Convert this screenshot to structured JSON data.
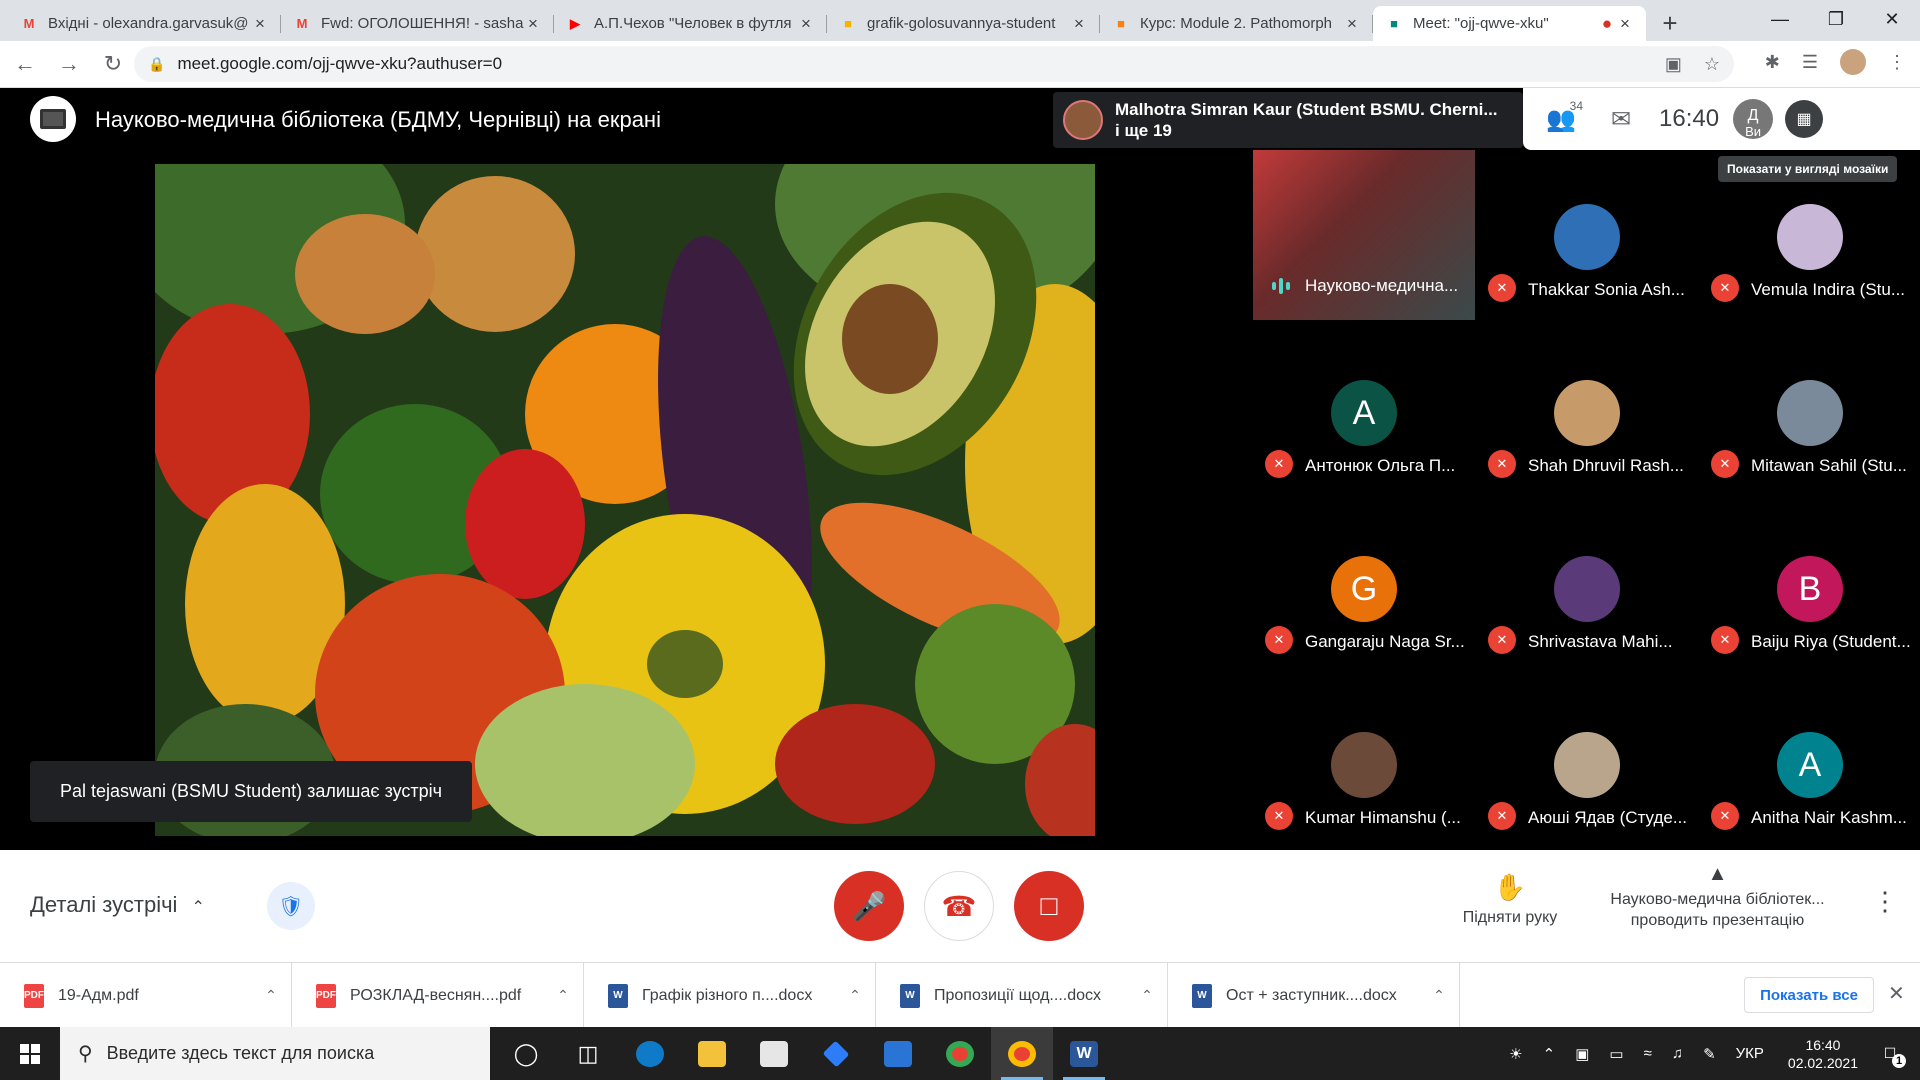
{
  "browser": {
    "tabs": [
      {
        "title": "Вхідні - olexandra.garvasuk@",
        "icon": "gmail-icon",
        "color": "#ea4335"
      },
      {
        "title": "Fwd: ОГОЛОШЕННЯ! - sasha",
        "icon": "gmail-icon",
        "color": "#ea4335"
      },
      {
        "title": "А.П.Чехов \"Человек в футля",
        "icon": "youtube-icon",
        "color": "#ff0000"
      },
      {
        "title": "grafik-golosuvannya-student",
        "icon": "doc-icon",
        "color": "#f4b400"
      },
      {
        "title": "Курс: Module 2. Pathomorph",
        "icon": "moodle-icon",
        "color": "#f98012"
      },
      {
        "title": "Meet: \"ojj-qwve-xku\"",
        "icon": "meet-icon",
        "color": "#00897b"
      }
    ],
    "url": "meet.google.com/ojj-qwve-xku?authuser=0"
  },
  "meet": {
    "presenter_title": "Науково-медична бібліотека (БДМУ, Чернівці) на екрані",
    "active_speaker": "Malhotra Simran Kaur (Student BSMU. Cherni...",
    "others": "і ще 19",
    "participant_count": "34",
    "time": "16:40",
    "you_label": "Ви",
    "you_initial": "Д",
    "tooltip": "Показати у вигляді мозаїки",
    "notice": "Pal tejaswani (BSMU Student) залишає зустріч",
    "participants": [
      {
        "name": "Науково-медична...",
        "initial": "",
        "color": "#8b3a3a",
        "speaking": true
      },
      {
        "name": "Thakkar Sonia Ash...",
        "initial": "",
        "color": "#2f6fb5",
        "speaking": false
      },
      {
        "name": "Vemula Indira (Stu...",
        "initial": "",
        "color": "#c9b7d8",
        "speaking": false
      },
      {
        "name": "Антонюк Ольга П...",
        "initial": "A",
        "color": "#0b5345",
        "speaking": false
      },
      {
        "name": "Shah Dhruvil Rash...",
        "initial": "",
        "color": "#c79a6a",
        "speaking": false
      },
      {
        "name": "Mitawan Sahil (Stu...",
        "initial": "",
        "color": "#7a8a9a",
        "speaking": false
      },
      {
        "name": "Gangaraju Naga Sr...",
        "initial": "G",
        "color": "#e8710a",
        "speaking": false
      },
      {
        "name": "Shrivastava Mahi...",
        "initial": "",
        "color": "#5b3a7a",
        "speaking": false
      },
      {
        "name": "Baiju Riya (Student...",
        "initial": "B",
        "color": "#c2185b",
        "speaking": false
      },
      {
        "name": "Kumar Himanshu (...",
        "initial": "",
        "color": "#6b4a3a",
        "speaking": false
      },
      {
        "name": "Аюші Ядав (Студе...",
        "initial": "",
        "color": "#b9a58c",
        "speaking": false
      },
      {
        "name": "Anitha Nair Kashm...",
        "initial": "A",
        "color": "#00838f",
        "speaking": false
      }
    ],
    "details_label": "Деталі зустрічі",
    "raise_hand": "Підняти руку",
    "presenting_line1": "Науково-медична бібліотек...",
    "presenting_line2": "проводить презентацію"
  },
  "downloads": {
    "items": [
      {
        "name": "19-Адм.pdf",
        "type": "pdf"
      },
      {
        "name": "РОЗКЛАД-веснян....pdf",
        "type": "pdf"
      },
      {
        "name": "Графік різного п....docx",
        "type": "doc"
      },
      {
        "name": "Пропозиції щод....docx",
        "type": "doc"
      },
      {
        "name": "Ост + заступник....docx",
        "type": "doc"
      }
    ],
    "show_all": "Показать все"
  },
  "taskbar": {
    "search_placeholder": "Введите здесь текст для поиска",
    "language": "УКР",
    "time": "16:40",
    "date": "02.02.2021",
    "notifications": "1"
  }
}
